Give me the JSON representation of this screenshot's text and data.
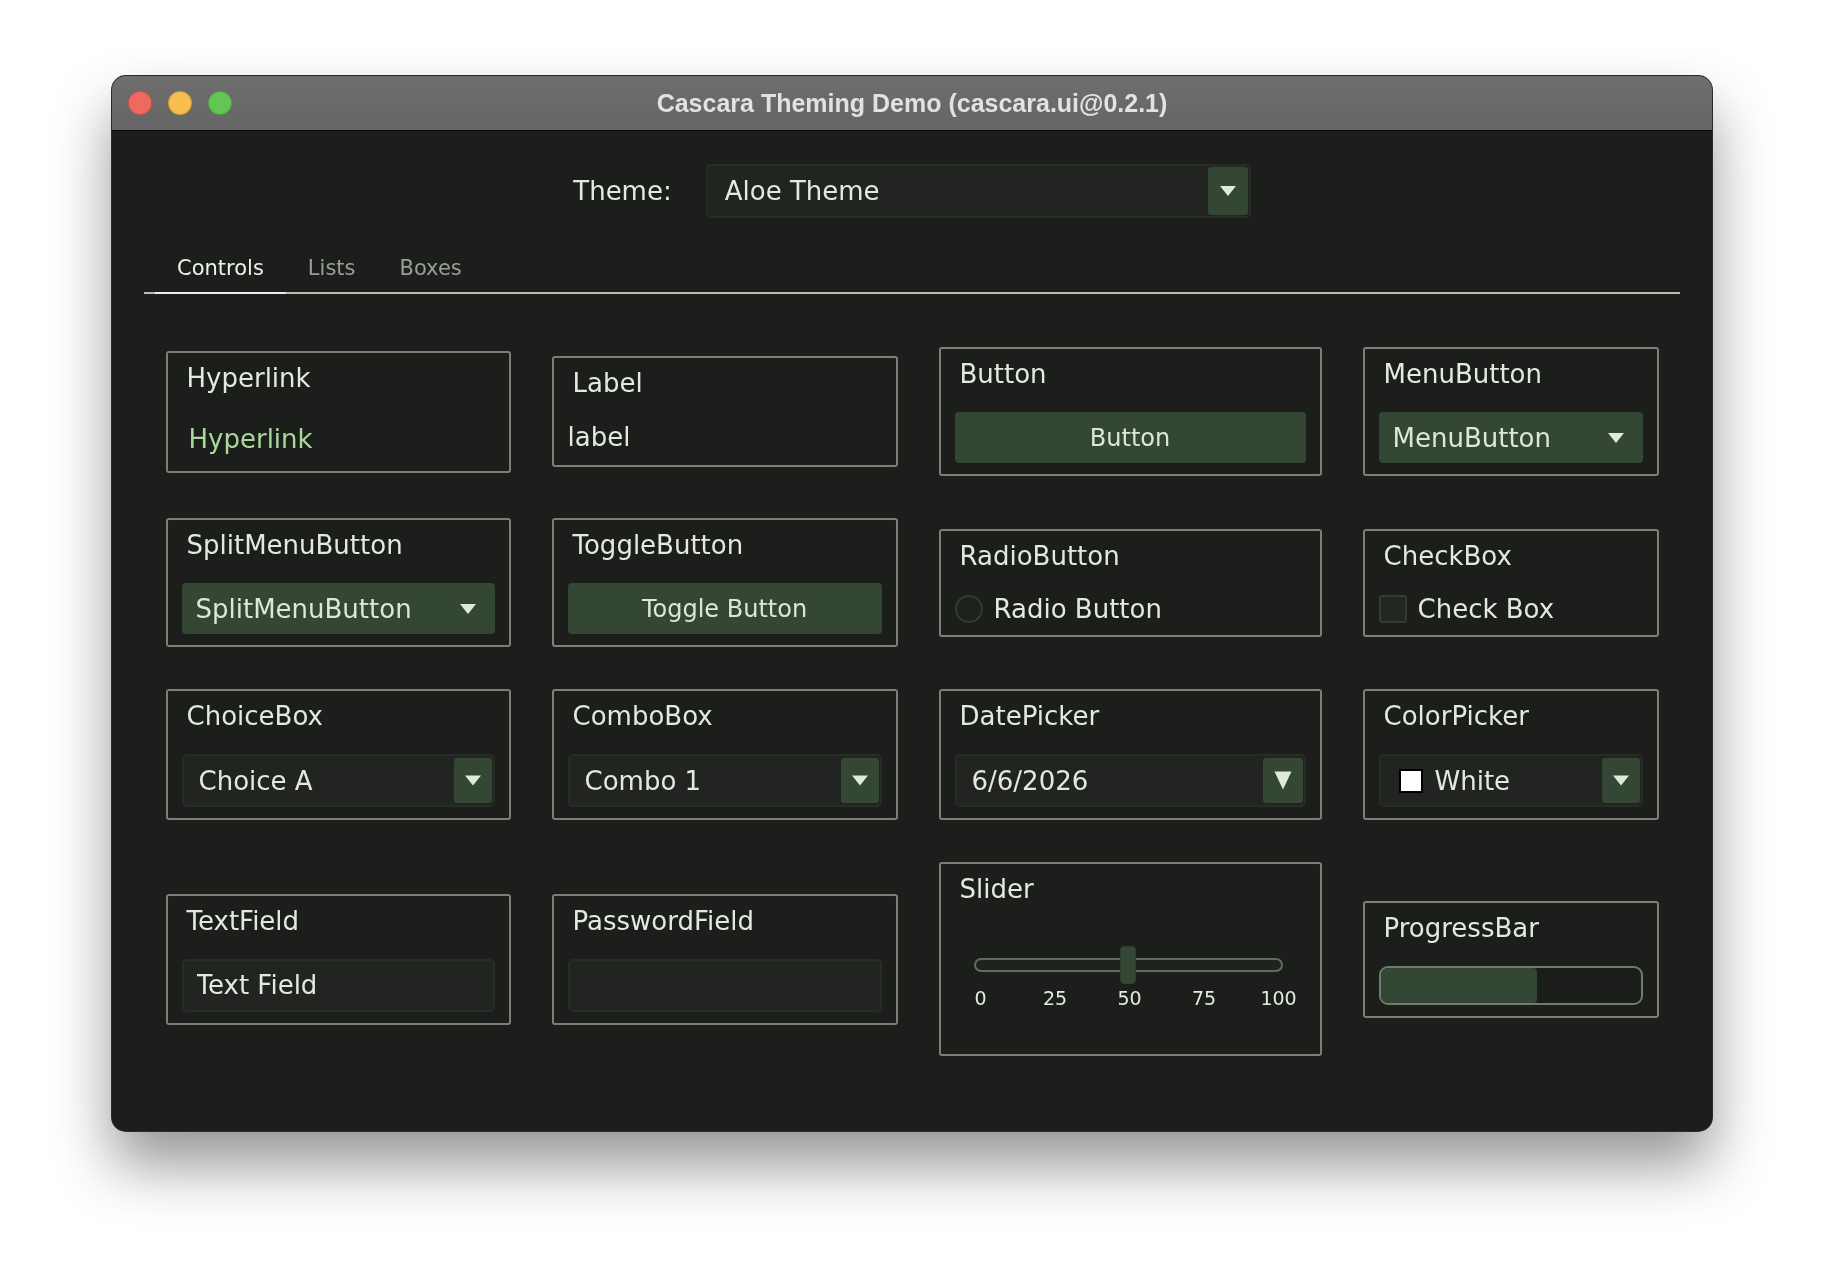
{
  "window": {
    "title": "Cascara Theming Demo (cascara.ui@0.2.1)"
  },
  "theme_selector": {
    "label": "Theme:",
    "value": "Aloe Theme"
  },
  "tabs": [
    {
      "label": "Controls",
      "selected": true
    },
    {
      "label": "Lists",
      "selected": false
    },
    {
      "label": "Boxes",
      "selected": false
    }
  ],
  "control_rows": [
    {
      "cards": [
        {
          "kind": "hyperlink",
          "title": "Hyperlink",
          "text": "Hyperlink"
        },
        {
          "kind": "label",
          "title": "Label",
          "text": "label"
        },
        {
          "kind": "button",
          "title": "Button",
          "text": "Button"
        },
        {
          "kind": "menu_button",
          "title": "MenuButton",
          "text": "MenuButton"
        }
      ]
    },
    {
      "cards": [
        {
          "kind": "split_menu_button",
          "title": "SplitMenuButton",
          "text": "SplitMenuButton"
        },
        {
          "kind": "toggle_button",
          "title": "ToggleButton",
          "text": "Toggle Button",
          "selected": false
        },
        {
          "kind": "radio_button",
          "title": "RadioButton",
          "text": "Radio Button",
          "selected": false
        },
        {
          "kind": "checkbox",
          "title": "CheckBox",
          "text": "Check Box",
          "checked": false
        }
      ]
    },
    {
      "cards": [
        {
          "kind": "choice_box",
          "title": "ChoiceBox",
          "value": "Choice A"
        },
        {
          "kind": "combo_box",
          "title": "ComboBox",
          "value": "Combo 1"
        },
        {
          "kind": "date_picker",
          "title": "DatePicker",
          "value": "6/6/2026"
        },
        {
          "kind": "color_picker",
          "title": "ColorPicker",
          "value": "White",
          "color": "#ffffff"
        }
      ]
    },
    {
      "cards": [
        {
          "kind": "text_field",
          "title": "TextField",
          "value": "Text Field"
        },
        {
          "kind": "password_field",
          "title": "PasswordField"
        },
        {
          "kind": "slider",
          "title": "Slider",
          "level": 0.5,
          "tick_labels": [
            "0",
            "25",
            "50",
            "75",
            "100"
          ]
        },
        {
          "kind": "progress_bar",
          "title": "ProgressBar",
          "level": 0.6
        }
      ]
    }
  ]
}
